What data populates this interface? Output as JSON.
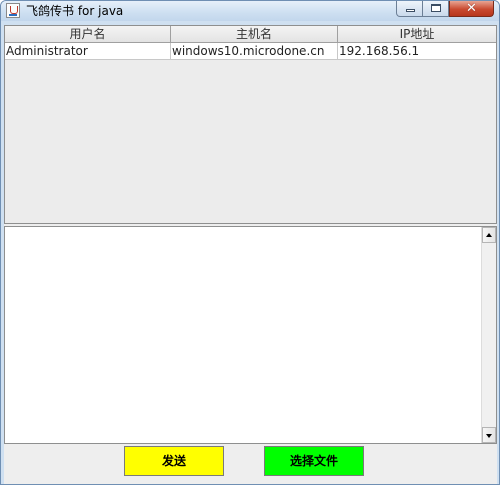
{
  "window": {
    "title": "飞鸽传书 for java",
    "close_glyph": "✕"
  },
  "user_table": {
    "columns": [
      "用户名",
      "主机名",
      "IP地址"
    ],
    "rows": [
      [
        "Administrator",
        "windows10.microdone.cn",
        "192.168.56.1"
      ]
    ]
  },
  "message": {
    "value": ""
  },
  "buttons": {
    "send": {
      "label": "发送",
      "color": "#ffff00"
    },
    "choose_file": {
      "label": "选择文件",
      "color": "#00ff00"
    }
  },
  "icons": {
    "app": "java-coffee-cup-icon",
    "minimize": "minimize-icon",
    "maximize": "maximize-icon",
    "close": "close-icon",
    "scroll_up": "arrow-up-icon",
    "scroll_down": "arrow-down-icon"
  }
}
